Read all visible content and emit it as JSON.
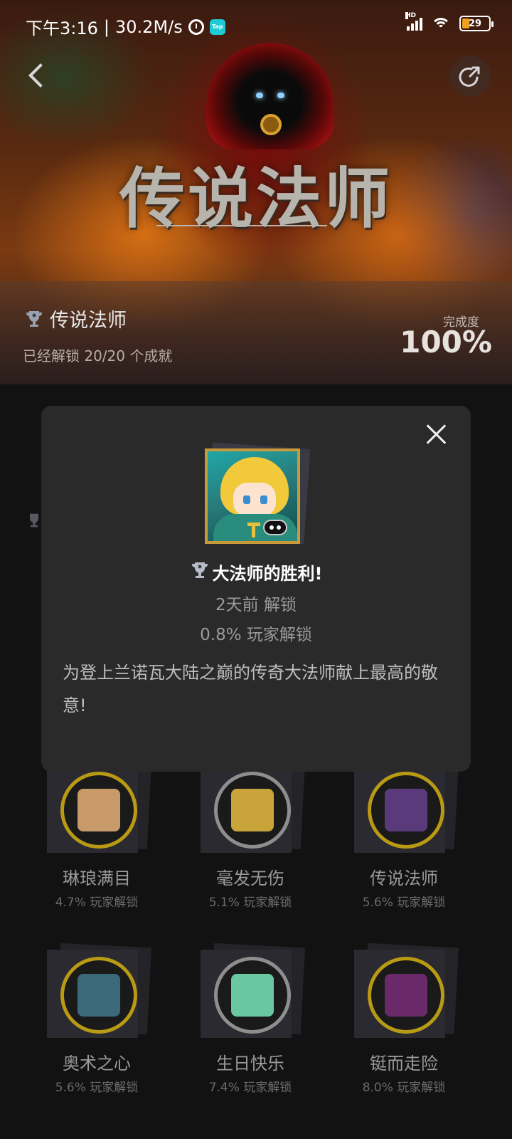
{
  "status_bar": {
    "time": "下午3:16",
    "separator": "|",
    "speed": "30.2M/s",
    "tap_badge": "Tap",
    "signal_hd": "HD",
    "battery": "29",
    "icons": [
      "alarm-icon",
      "tap-icon",
      "signal-icon",
      "wifi-icon",
      "battery-icon"
    ]
  },
  "header": {
    "game_logo": "传说法师",
    "back_icon": "chevron-left-icon",
    "share_icon": "share-icon"
  },
  "summary": {
    "title": "传说法师",
    "subtitle": "已经解锁 20/20 个成就",
    "completion_label": "完成度",
    "completion_value": "100%"
  },
  "modal": {
    "title": "大法师的胜利!",
    "unlocked_time": "2天前 解锁",
    "unlock_rate": "0.8% 玩家解锁",
    "description": "为登上兰诺瓦大陆之巅的传奇大法师献上最高的敬意!",
    "close_icon": "close-icon"
  },
  "achievements": [
    {
      "name": "琳琅满目",
      "rate": "4.7% 玩家解锁",
      "tier": "gold",
      "icon": "spool-icon",
      "color": "#c89a6a"
    },
    {
      "name": "毫发无伤",
      "rate": "5.1% 玩家解锁",
      "tier": "silver",
      "icon": "p-block-icon",
      "color": "#c8a43a"
    },
    {
      "name": "传说法师",
      "rate": "5.6% 玩家解锁",
      "tier": "gold",
      "icon": "wizard-icon",
      "color": "#5a3a7a"
    },
    {
      "name": "奥术之心",
      "rate": "5.6% 玩家解锁",
      "tier": "gold",
      "icon": "spellbook-icon",
      "color": "#3a6a7a"
    },
    {
      "name": "生日快乐",
      "rate": "7.4% 玩家解锁",
      "tier": "silver",
      "icon": "rainbow-llama-icon",
      "color": "#6ac8a0"
    },
    {
      "name": "铤而走险",
      "rate": "8.0% 玩家解锁",
      "tier": "gold",
      "icon": "skull-flame-icon",
      "color": "#6a2a6a"
    }
  ],
  "colors": {
    "modal_bg": "#2a2a2a",
    "page_bg": "#121212",
    "gold_ring": "#b89a14",
    "silver_ring": "#8e8e8e",
    "battery_fill": "#f0a020",
    "tap_brand": "#1ecad3"
  }
}
